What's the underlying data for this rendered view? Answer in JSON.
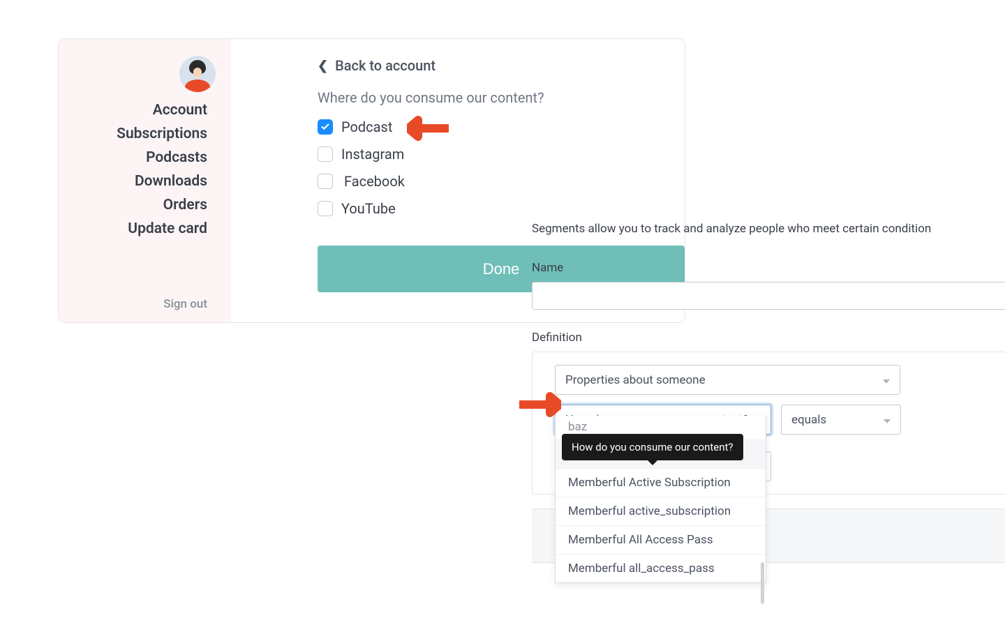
{
  "sidebar": {
    "items": [
      "Account",
      "Subscriptions",
      "Podcasts",
      "Downloads",
      "Orders",
      "Update card"
    ],
    "sign_out": "Sign out"
  },
  "main": {
    "back_label": "Back to account",
    "question": "Where do you consume our content?",
    "options": [
      {
        "label": "Podcast",
        "checked": true
      },
      {
        "label": "Instagram",
        "checked": false
      },
      {
        "label": "Facebook",
        "checked": false
      },
      {
        "label": "YouTube",
        "checked": false
      }
    ],
    "done": "Done"
  },
  "segments": {
    "intro": "Segments allow you to track and analyze people who meet certain condition",
    "name_label": "Name",
    "definition_label": "Definition",
    "select_properties": "Properties about someone",
    "select_content_q": "How do you consume our content?",
    "select_equals": "equals",
    "dropdown": {
      "partial": "baz",
      "tooltip": "How do you consume our content?",
      "items": [
        "How do you consume our cont...",
        "Memberful Active Subscription",
        "Memberful active_subscription",
        "Memberful All Access Pass",
        "Memberful all_access_pass"
      ]
    }
  }
}
